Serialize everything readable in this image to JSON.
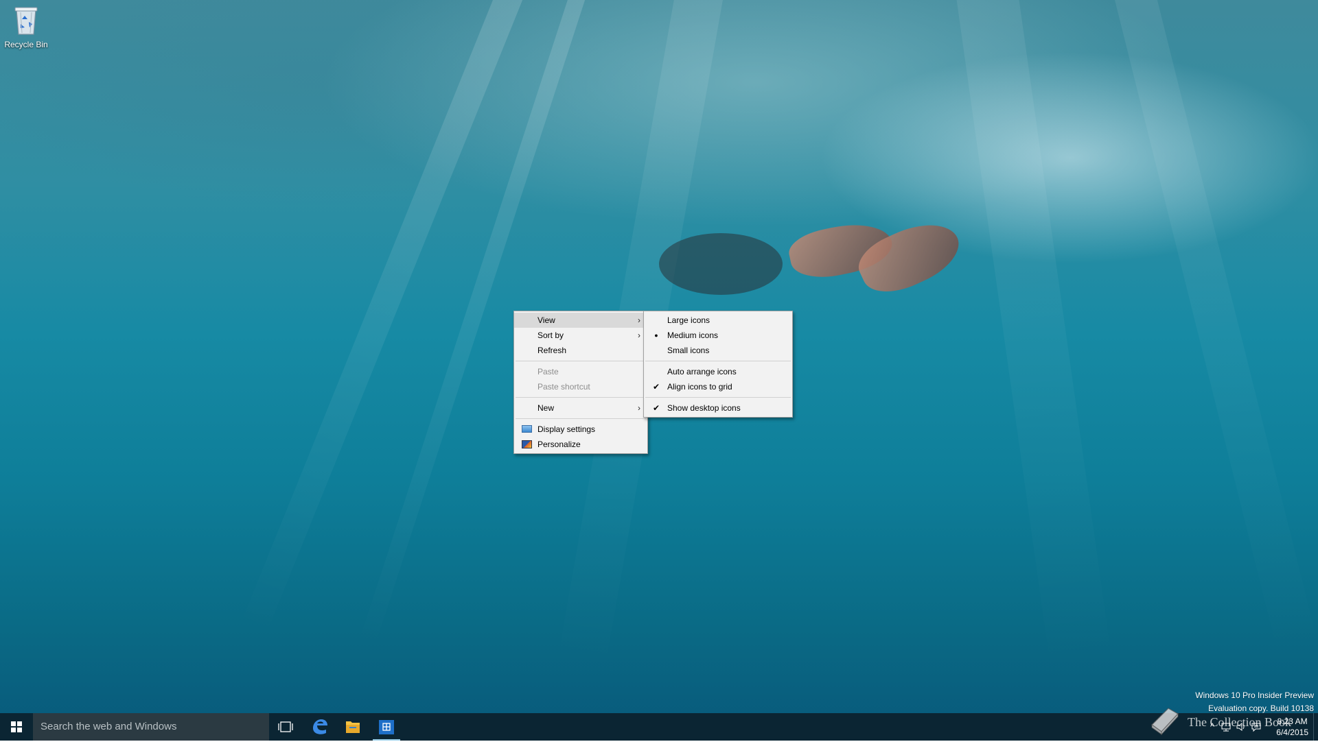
{
  "desktop": {
    "icons": [
      {
        "label": "Recycle Bin",
        "icon": "recycle-bin-icon"
      }
    ]
  },
  "context_menu": {
    "items": [
      {
        "label": "View",
        "submenu": true,
        "highlighted": true,
        "enabled": true
      },
      {
        "label": "Sort by",
        "submenu": true,
        "enabled": true
      },
      {
        "label": "Refresh",
        "enabled": true
      },
      {
        "label": "Paste",
        "enabled": false
      },
      {
        "label": "Paste shortcut",
        "enabled": false
      },
      {
        "label": "New",
        "submenu": true,
        "enabled": true
      },
      {
        "label": "Display settings",
        "icon": "display-settings-icon",
        "enabled": true
      },
      {
        "label": "Personalize",
        "icon": "personalize-icon",
        "enabled": true
      }
    ],
    "arrow_glyph": "›"
  },
  "view_submenu": {
    "items": [
      {
        "label": "Large icons",
        "mark": ""
      },
      {
        "label": "Medium icons",
        "mark": "●"
      },
      {
        "label": "Small icons",
        "mark": ""
      },
      {
        "label": "Auto arrange icons",
        "mark": ""
      },
      {
        "label": "Align icons to grid",
        "mark": "✔"
      },
      {
        "label": "Show desktop icons",
        "mark": "✔"
      }
    ]
  },
  "watermark": {
    "line1": "Windows 10 Pro Insider Preview",
    "line2": "Evaluation copy. Build 10138"
  },
  "taskbar": {
    "search_placeholder": "Search the web and Windows",
    "pinned": [
      {
        "name": "task-view",
        "icon": "task-view-icon"
      },
      {
        "name": "edge",
        "icon": "edge-icon"
      },
      {
        "name": "file-explorer",
        "icon": "folder-icon"
      },
      {
        "name": "store",
        "icon": "store-icon",
        "active": true
      }
    ],
    "clock": {
      "time": "8:23 AM",
      "date": "6/4/2015"
    }
  },
  "overlay_logo": {
    "text": "The Collection Book"
  },
  "colors": {
    "menu_bg": "#f2f2f2",
    "menu_highlight": "#d9d9d9",
    "taskbar_bg": "#0b2533",
    "search_bg": "#2b3a42",
    "accent": "#1e6fc8"
  }
}
